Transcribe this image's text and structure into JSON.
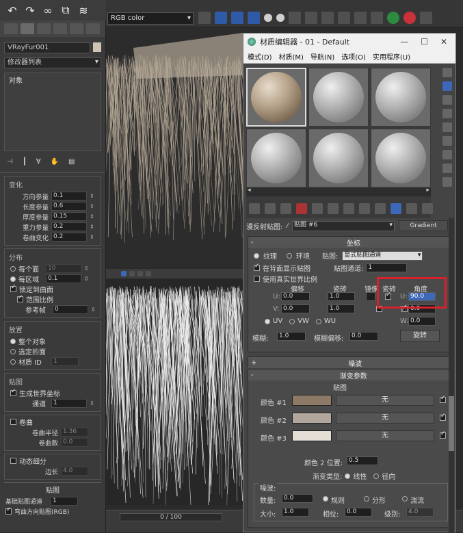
{
  "top_toolbar": {
    "render_select": "RGB color"
  },
  "command_panel": {
    "object_name": "VRayFur001",
    "modifier_list": "修改器列表",
    "stack_label": "对象",
    "variation": {
      "title": "变化",
      "rows": [
        {
          "label": "方向参量",
          "value": "0.1"
        },
        {
          "label": "长度参量",
          "value": "0.6"
        },
        {
          "label": "厚度参量",
          "value": "0.15"
        },
        {
          "label": "重力参量",
          "value": "0.2"
        },
        {
          "label": "卷曲变化",
          "value": "0.2"
        }
      ]
    },
    "distribution": {
      "title": "分布",
      "per_face": "每个面",
      "per_face_value": "10",
      "per_area": "每区域",
      "per_area_value": "0.1",
      "lock_to_surface": "锁定到曲面",
      "scale_ratio": "范围比例",
      "ref_frame": "参考帧",
      "ref_frame_value": "0"
    },
    "placement": {
      "title": "放置",
      "whole_object": "整个对象",
      "selected_faces": "选定的面",
      "material_id": "材质 ID",
      "material_id_value": "1"
    },
    "mapping": {
      "title": "贴图",
      "gen_world_coords": "生成世界坐标",
      "channel": "通道",
      "channel_value": "1"
    },
    "curl": {
      "title": "卷曲",
      "radius_label": "卷曲半径",
      "radius_value": "1.36",
      "count_label": "卷曲数",
      "count_value": "0.0"
    },
    "dynamic_subdiv": {
      "title": "动态细分",
      "edge_label": "边长",
      "edge_value": "4.0"
    },
    "maps": {
      "title": "贴图",
      "base_channel_label": "基础贴图通道",
      "base_channel_value": "1",
      "bend_dir": "弯曲方向贴图(RGB)"
    }
  },
  "timeline": {
    "frame_label": "0 / 100"
  },
  "material_editor": {
    "title": "材质编辑器 - 01 - Default",
    "menu": [
      "模式(D)",
      "材质(M)",
      "导航(N)",
      "选项(O)",
      "实用程序(U)"
    ],
    "map_label": "漫反射贴图:",
    "map_name": "贴图 #6",
    "map_type": "Gradient",
    "coordinates": {
      "title": "坐标",
      "texture": "纹理",
      "environment": "环境",
      "map_label": "贴图:",
      "map_value": "显式贴图通道",
      "show_on_back": "在背面显示贴图",
      "map_channel_label": "贴图通道:",
      "map_channel_value": "1",
      "real_world": "使用真实世界比例",
      "offset_label": "偏移",
      "tiling_label": "瓷砖",
      "mirror_label": "镜像",
      "tile_label": "瓷砖",
      "angle_label": "角度",
      "u_offset": "0.0",
      "v_offset": "0.0",
      "u_tiling": "1.0",
      "v_tiling": "1.0",
      "u_angle": "90.0",
      "v_angle": "0.0",
      "w_angle": "0.0",
      "uv": "UV",
      "vw": "VW",
      "wu": "WU",
      "blur_label": "模糊:",
      "blur_value": "1.0",
      "blur_offset_label": "模糊偏移:",
      "blur_offset_value": "0.0",
      "rotate_button": "旋转"
    },
    "noise_rollout": "噪波",
    "gradient": {
      "title": "渐变参数",
      "map_label": "贴图",
      "colors": [
        {
          "label": "颜色 #1",
          "hex": "#8c7a66",
          "map": "无"
        },
        {
          "label": "颜色 #2",
          "hex": "#b1a79c",
          "map": "无"
        },
        {
          "label": "颜色 #3",
          "hex": "#e3ddd5",
          "map": "无"
        }
      ],
      "color2_pos_label": "颜色 2 位置:",
      "color2_pos_value": "0.5",
      "gradient_type_label": "渐变类型:",
      "linear": "线性",
      "radial": "径向",
      "noise_group": "噪波:",
      "amount_label": "数量:",
      "amount_value": "0.0",
      "regular": "规则",
      "fractal": "分形",
      "turbulence": "湍流",
      "size_label": "大小:",
      "size_value": "1.0",
      "phase_label": "相位:",
      "phase_value": "0.0",
      "levels_label": "级别:",
      "levels_value": "4.0"
    }
  }
}
